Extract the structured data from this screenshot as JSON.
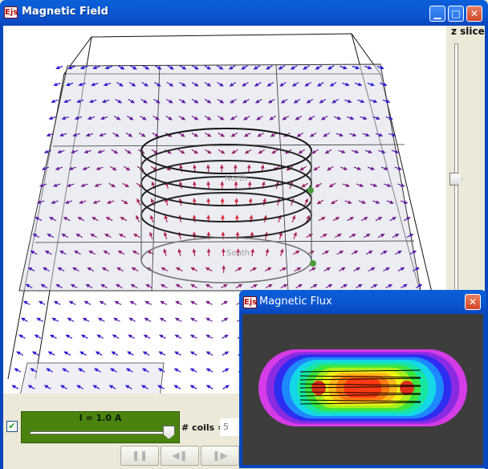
{
  "main_window": {
    "title": "Magnetic Field",
    "icon_label": "Ejs",
    "buttons": {
      "minimize": "▁",
      "maximize": "□",
      "close": "✕"
    }
  },
  "viewport": {
    "north_label": "North",
    "south_label": "South"
  },
  "z_slice": {
    "label": "z slice"
  },
  "controls": {
    "checkbox_checked": true,
    "current_label": "I = 1.0 A",
    "coils_label": "# coils =",
    "coils_value": "5"
  },
  "player": {
    "pause_icon": "❚❚",
    "step_back_icon": "◀❚",
    "step_forward_icon": "❚▶"
  },
  "flux_window": {
    "title": "Magnetic Flux",
    "icon_label": "Ejs",
    "close": "✕"
  },
  "colors": {
    "titlebar": "#0A5FD8",
    "strong_field": "#E52222",
    "weak_field": "#2A1AD6",
    "current_panel": "#4B8310",
    "flux_background": "#3D3D3D"
  }
}
